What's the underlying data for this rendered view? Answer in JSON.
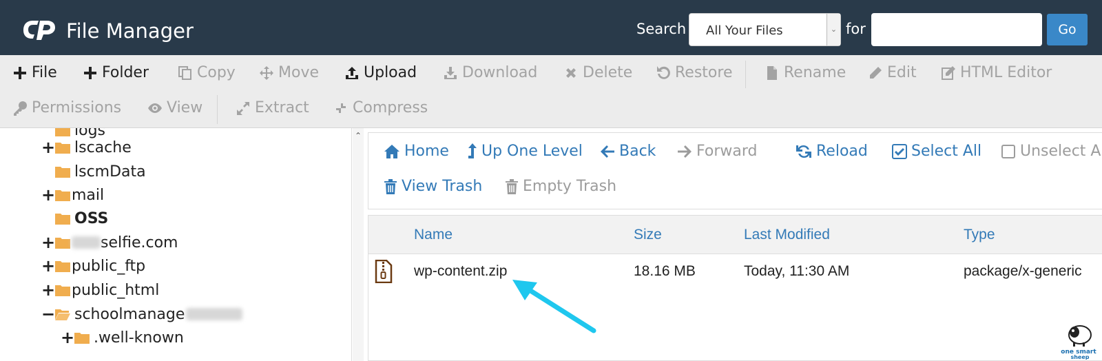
{
  "header": {
    "title": "File Manager",
    "search_label": "Search",
    "search_scope": "All Your Files",
    "for_label": "for",
    "search_value": "",
    "go_label": "Go"
  },
  "toolbar": {
    "row1": [
      {
        "label": "File",
        "icon": "plus-icon",
        "enabled": true
      },
      {
        "label": "Folder",
        "icon": "plus-icon",
        "enabled": true
      },
      {
        "label": "Copy",
        "icon": "copy-icon",
        "enabled": false
      },
      {
        "label": "Move",
        "icon": "move-icon",
        "enabled": false
      },
      {
        "label": "Upload",
        "icon": "upload-icon",
        "enabled": true
      },
      {
        "label": "Download",
        "icon": "download-icon",
        "enabled": false
      },
      {
        "label": "Delete",
        "icon": "delete-icon",
        "enabled": false
      },
      {
        "label": "Restore",
        "icon": "restore-icon",
        "enabled": false
      },
      {
        "label": "Rename",
        "icon": "file-icon",
        "enabled": false
      },
      {
        "label": "Edit",
        "icon": "pencil-icon",
        "enabled": false
      },
      {
        "label": "HTML Editor",
        "icon": "edit-icon",
        "enabled": false
      }
    ],
    "row2": [
      {
        "label": "Permissions",
        "icon": "key-icon",
        "enabled": false
      },
      {
        "label": "View",
        "icon": "eye-icon",
        "enabled": false
      },
      {
        "label": "Extract",
        "icon": "expand-icon",
        "enabled": false
      },
      {
        "label": "Compress",
        "icon": "compress-icon",
        "enabled": false
      }
    ]
  },
  "tree": {
    "nodes": [
      {
        "label": "logs",
        "toggle": "",
        "bold": false
      },
      {
        "label": "lscache",
        "toggle": "+",
        "bold": false
      },
      {
        "label": "lscmData",
        "toggle": "",
        "bold": false
      },
      {
        "label": "mail",
        "toggle": "+",
        "bold": false
      },
      {
        "label": "OSS",
        "toggle": "",
        "bold": true
      },
      {
        "label": "selfie.com",
        "toggle": "+",
        "bold": false
      },
      {
        "label": "public_ftp",
        "toggle": "+",
        "bold": false
      },
      {
        "label": "public_html",
        "toggle": "+",
        "bold": false
      },
      {
        "label": "schoolmanage",
        "toggle": "−",
        "bold": false
      },
      {
        "label": ".well-known",
        "toggle": "+",
        "bold": false
      }
    ]
  },
  "navbar": {
    "row1": [
      {
        "label": "Home",
        "icon": "home-icon",
        "enabled": true
      },
      {
        "label": "Up One Level",
        "icon": "level-up-icon",
        "enabled": true
      },
      {
        "label": "Back",
        "icon": "arrow-left-icon",
        "enabled": true
      },
      {
        "label": "Forward",
        "icon": "arrow-right-icon",
        "enabled": false
      },
      {
        "label": "Reload",
        "icon": "reload-icon",
        "enabled": true
      },
      {
        "label": "Select All",
        "icon": "checkbox-checked-icon",
        "enabled": true
      },
      {
        "label": "Unselect All",
        "icon": "checkbox-empty-icon",
        "enabled": false
      }
    ],
    "row2": [
      {
        "label": "View Trash",
        "icon": "trash-icon",
        "enabled": true
      },
      {
        "label": "Empty Trash",
        "icon": "trash-icon",
        "enabled": false
      }
    ]
  },
  "table": {
    "columns": [
      "Name",
      "Size",
      "Last Modified",
      "Type"
    ],
    "rows": [
      {
        "name": "wp-content.zip",
        "size": "18.16 MB",
        "modified": "Today, 11:30 AM",
        "type": "package/x-generic",
        "icon": "zip-file-icon"
      }
    ]
  },
  "colors": {
    "header_bg": "#293a4a",
    "link_blue": "#337ab7",
    "go_button": "#3a88c8",
    "folder_orange": "#f0ad4e",
    "annotation_arrow": "#1fc7ee"
  },
  "watermark": {
    "text": "one smart sheep"
  }
}
